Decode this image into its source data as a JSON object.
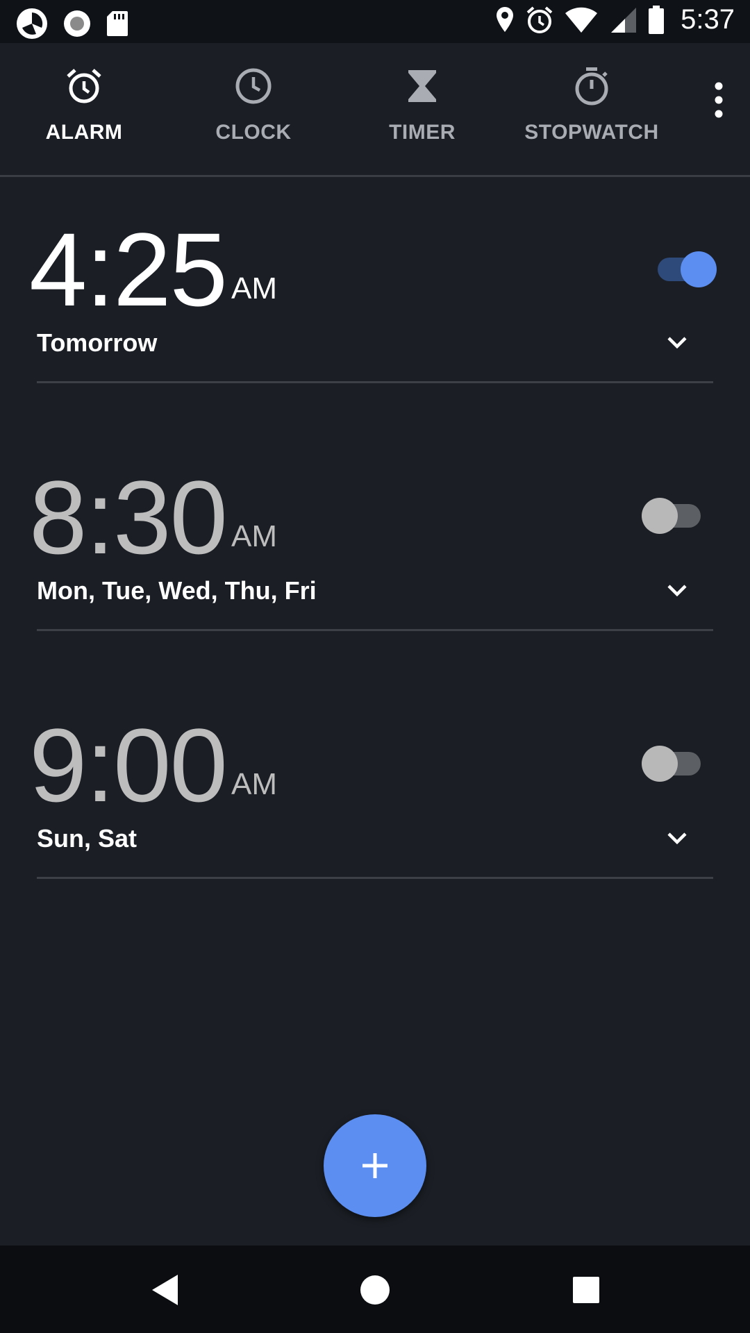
{
  "status_bar": {
    "time": "5:37",
    "left_icons": [
      "app-icon",
      "record-icon",
      "sd-card-icon"
    ],
    "right_icons": [
      "location-icon",
      "alarm-icon",
      "wifi-icon",
      "signal-icon",
      "battery-icon"
    ]
  },
  "tabs": [
    {
      "label": "ALARM",
      "icon": "alarm-clock-icon",
      "active": true
    },
    {
      "label": "CLOCK",
      "icon": "clock-icon",
      "active": false
    },
    {
      "label": "TIMER",
      "icon": "hourglass-icon",
      "active": false
    },
    {
      "label": "STOPWATCH",
      "icon": "stopwatch-icon",
      "active": false
    }
  ],
  "alarms": [
    {
      "time": "4:25",
      "period": "AM",
      "repeat": "Tomorrow",
      "enabled": true
    },
    {
      "time": "8:30",
      "period": "AM",
      "repeat": "Mon, Tue, Wed, Thu, Fri",
      "enabled": false
    },
    {
      "time": "9:00",
      "period": "AM",
      "repeat": "Sun, Sat",
      "enabled": false
    }
  ],
  "fab": {
    "icon": "plus-icon"
  },
  "colors": {
    "accent": "#5b8ef0",
    "background": "#1b1f25"
  }
}
